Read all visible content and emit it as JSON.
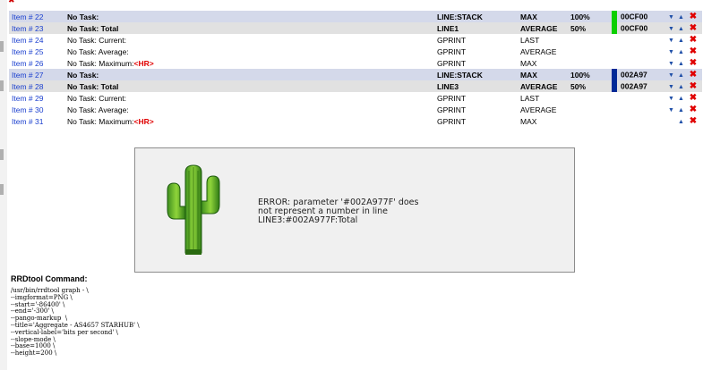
{
  "rows": [
    {
      "item": "Item # 22",
      "task": "No Task:",
      "task_tag": "",
      "type": "LINE:STACK",
      "cf": "MAX",
      "pct": "100%",
      "color_hex": "#0ccf00",
      "color_code": "00CF00",
      "style": "stack",
      "bold": true,
      "arrows": 2
    },
    {
      "item": "Item # 23",
      "task": "No Task: Total",
      "task_tag": "",
      "type": "LINE1",
      "cf": "AVERAGE",
      "pct": "50%",
      "color_hex": "#0ccf00",
      "color_code": "00CF00",
      "style": "total",
      "bold": true,
      "arrows": 2
    },
    {
      "item": "Item # 24",
      "task": "No Task: Current:",
      "task_tag": "",
      "type": "GPRINT",
      "cf": "LAST",
      "pct": "",
      "color_hex": "",
      "color_code": "",
      "style": "gprint",
      "bold": false,
      "arrows": 2
    },
    {
      "item": "Item # 25",
      "task": "No Task: Average:",
      "task_tag": "",
      "type": "GPRINT",
      "cf": "AVERAGE",
      "pct": "",
      "color_hex": "",
      "color_code": "",
      "style": "gprint",
      "bold": false,
      "arrows": 2
    },
    {
      "item": "Item # 26",
      "task": "No Task: Maximum:",
      "task_tag": "<HR>",
      "type": "GPRINT",
      "cf": "MAX",
      "pct": "",
      "color_hex": "",
      "color_code": "",
      "style": "gprint",
      "bold": false,
      "arrows": 2
    },
    {
      "item": "Item # 27",
      "task": "No Task:",
      "task_tag": "",
      "type": "LINE:STACK",
      "cf": "MAX",
      "pct": "100%",
      "color_hex": "#002a97",
      "color_code": "002A97",
      "style": "stack",
      "bold": true,
      "arrows": 2
    },
    {
      "item": "Item # 28",
      "task": "No Task: Total",
      "task_tag": "",
      "type": "LINE3",
      "cf": "AVERAGE",
      "pct": "50%",
      "color_hex": "#002a97",
      "color_code": "002A97",
      "style": "total",
      "bold": true,
      "arrows": 2
    },
    {
      "item": "Item # 29",
      "task": "No Task: Current:",
      "task_tag": "",
      "type": "GPRINT",
      "cf": "LAST",
      "pct": "",
      "color_hex": "",
      "color_code": "",
      "style": "gprint",
      "bold": false,
      "arrows": 2
    },
    {
      "item": "Item # 30",
      "task": "No Task: Average:",
      "task_tag": "",
      "type": "GPRINT",
      "cf": "AVERAGE",
      "pct": "",
      "color_hex": "",
      "color_code": "",
      "style": "gprint",
      "bold": false,
      "arrows": 2
    },
    {
      "item": "Item # 31",
      "task": "No Task: Maximum:",
      "task_tag": "<HR>",
      "type": "GPRINT",
      "cf": "MAX",
      "pct": "",
      "color_hex": "",
      "color_code": "",
      "style": "gprint",
      "bold": false,
      "arrows": 1
    }
  ],
  "icons": {
    "move_down": "▼",
    "move_up": "▲",
    "delete": "✖"
  },
  "error": {
    "line1": "ERROR: parameter '#002A977F' does",
    "line2": "not represent a number in line",
    "line3": "LINE3:#002A977F:Total"
  },
  "command": {
    "title": "RRDtool Command:",
    "lines": [
      "/usr/bin/rrdtool graph - \\",
      "--imgformat=PNG \\",
      "--start='-86400' \\",
      "--end='-300' \\",
      "--pango-markup  \\",
      "--title='Aggregate - AS4657 STARHUB' \\",
      "--vertical-label='bits per second' \\",
      "--slope-mode \\",
      "--base=1000 \\",
      "--height=200 \\"
    ]
  }
}
